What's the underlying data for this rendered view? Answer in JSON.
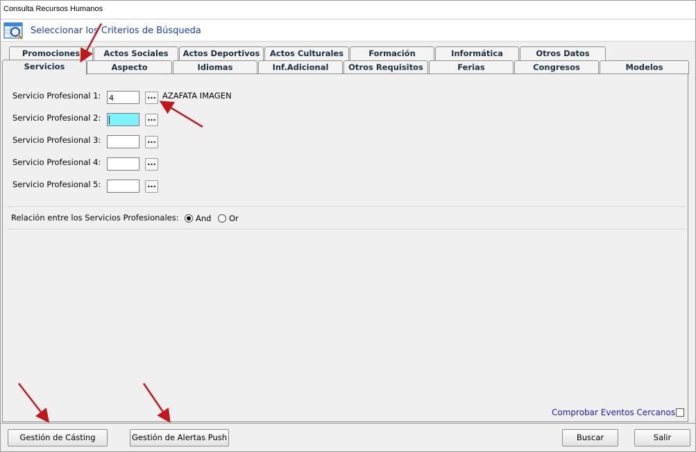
{
  "window": {
    "title": "Consulta Recursos Humanos"
  },
  "header": {
    "label": "Seleccionar los Criterios de Búsqueda",
    "icon": "search-table-icon"
  },
  "tabs_back": [
    "Promociones",
    "Actos Sociales",
    "Actos Deportivos",
    "Actos Culturales",
    "Formación",
    "Informática",
    "Otros Datos"
  ],
  "tabs_front": [
    "Servicios",
    "Aspecto",
    "Idiomas",
    "Inf.Adicional",
    "Otros Requisitos",
    "Ferias",
    "Congresos",
    "Modelos"
  ],
  "active_tab": "Servicios",
  "fields": [
    {
      "label": "Servicio Profesional 1:",
      "value": "4",
      "desc": "AZAFATA IMAGEN",
      "button": "..."
    },
    {
      "label": "Servicio Profesional 2:",
      "value": "",
      "desc": "",
      "button": "..."
    },
    {
      "label": "Servicio Profesional 3:",
      "value": "",
      "desc": "",
      "button": "..."
    },
    {
      "label": "Servicio Profesional 4:",
      "value": "",
      "desc": "",
      "button": "..."
    },
    {
      "label": "Servicio Profesional 5:",
      "value": "",
      "desc": "",
      "button": "..."
    }
  ],
  "relation": {
    "label": "Relación entre los Servicios Profesionales:",
    "and_label": "And",
    "or_label": "Or",
    "selected": "And"
  },
  "check_events": {
    "label": "Comprobar Eventos Cercanos.",
    "checked": false
  },
  "buttons": {
    "casting": "Gestión de Cásting",
    "push": "Gestión de Alertas Push",
    "search": "Buscar",
    "exit": "Salir"
  },
  "colors": {
    "focus_input": "#80f2fb",
    "link": "#1a1ab0",
    "arrow": "#c0181c",
    "header_text": "#1a3fb0"
  }
}
